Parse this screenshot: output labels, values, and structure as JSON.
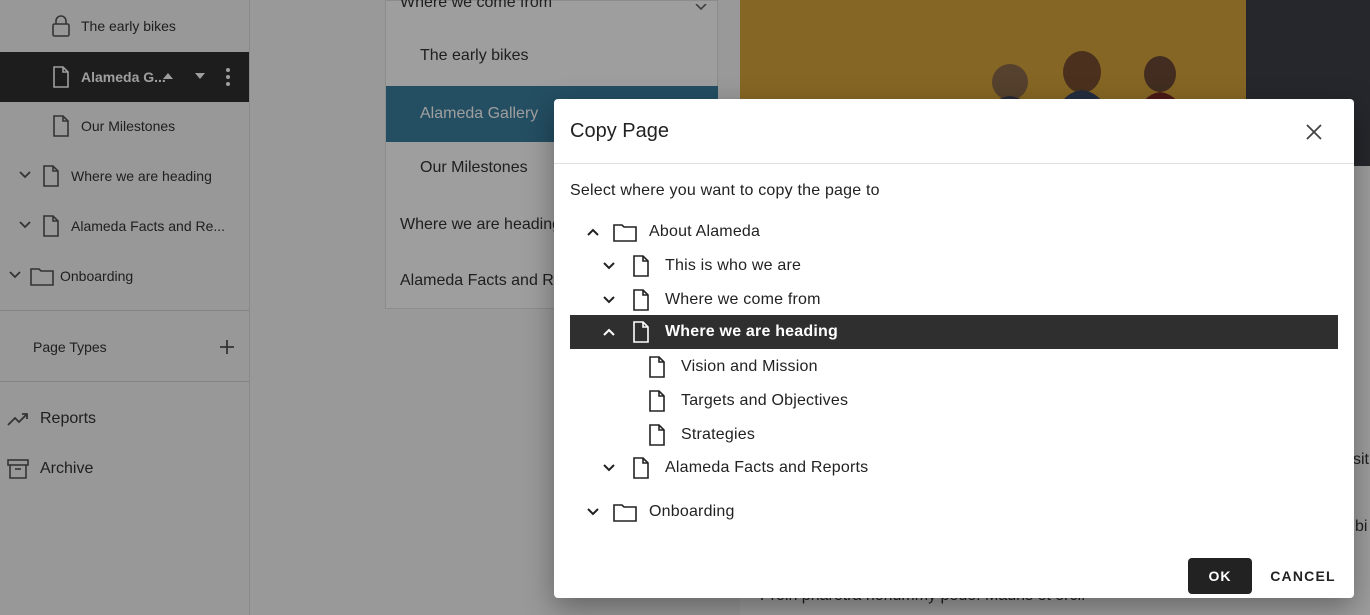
{
  "sidebar": {
    "tree": [
      {
        "label": "The early bikes",
        "icon": "lock-icon"
      },
      {
        "label": "Alameda G...",
        "icon": "page-icon"
      },
      {
        "label": "Our Milestones",
        "icon": "page-icon"
      },
      {
        "label": "Where we are heading",
        "icon": "page-icon"
      },
      {
        "label": "Alameda Facts and Re...",
        "icon": "page-icon"
      },
      {
        "label": "Onboarding",
        "icon": "folder-icon"
      }
    ],
    "page_types_label": "Page Types",
    "reports_label": "Reports",
    "archive_label": "Archive"
  },
  "site_menu": {
    "items": [
      "Where we come from",
      "The early bikes",
      "Alameda Gallery",
      "Our Milestones",
      "Where we are heading",
      "Alameda Facts and Re"
    ]
  },
  "content": {
    "fragments": [
      "sit",
      "bi",
      "Proin pharetra nonummy pede. Mauris et orci."
    ]
  },
  "dialog": {
    "title": "Copy Page",
    "instruction": "Select where you want to copy the page to",
    "tree": [
      {
        "label": "About Alameda",
        "icon": "folder-icon",
        "expander": "chevron-up-icon"
      },
      {
        "label": "This is who we are",
        "icon": "page-icon",
        "expander": "chevron-down-icon"
      },
      {
        "label": "Where we come from",
        "icon": "page-icon",
        "expander": "chevron-down-icon"
      },
      {
        "label": "Where we are heading",
        "icon": "page-icon",
        "expander": "chevron-up-icon",
        "selected": true
      },
      {
        "label": "Vision and Mission",
        "icon": "page-icon"
      },
      {
        "label": "Targets and Objectives",
        "icon": "page-icon"
      },
      {
        "label": "Strategies",
        "icon": "page-icon"
      },
      {
        "label": "Alameda Facts and Reports",
        "icon": "page-icon",
        "expander": "chevron-down-icon"
      },
      {
        "label": "Onboarding",
        "icon": "folder-icon",
        "expander": "chevron-down-icon"
      }
    ],
    "ok_label": "OK",
    "cancel_label": "CANCEL"
  },
  "colors": {
    "selected_row": "#2f2f2f",
    "menu_active": "#3b7f9e",
    "primary_button": "#222222"
  }
}
